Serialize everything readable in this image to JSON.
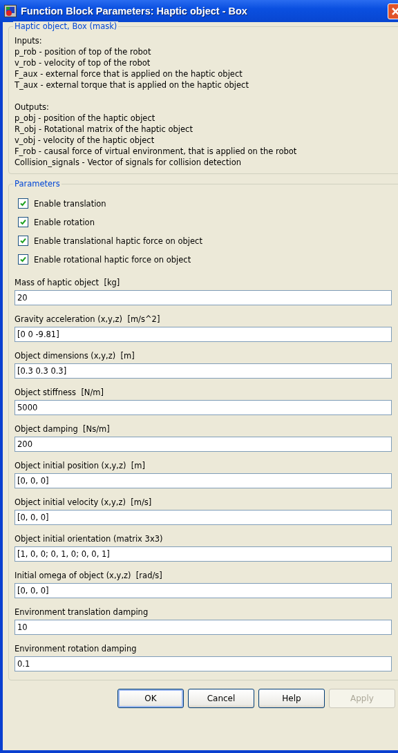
{
  "window": {
    "title": "Function Block Parameters: Haptic object - Box"
  },
  "description": {
    "title": "Haptic object, Box (mask)",
    "sections": [
      {
        "heading": "Inputs:",
        "lines": [
          "p_rob - position of top of the robot",
          "v_rob - velocity of top of the robot",
          "F_aux - external force that is applied on the haptic object",
          "T_aux - external torque that is applied on the haptic object"
        ]
      },
      {
        "heading": "Outputs:",
        "lines": [
          "p_obj - position of the haptic object",
          "R_obj - Rotational matrix of the haptic object",
          "v_obj - velocity of the haptic object",
          "F_rob - causal force of virtual environment, that is applied on the robot",
          "Collision_signals - Vector of signals for collision detection"
        ]
      }
    ]
  },
  "parameters": {
    "title": "Parameters",
    "checkboxes": [
      {
        "label": "Enable translation",
        "checked": true
      },
      {
        "label": "Enable rotation",
        "checked": true
      },
      {
        "label": "Enable translational haptic force on object",
        "checked": true
      },
      {
        "label": "Enable rotational haptic force on object",
        "checked": true
      }
    ],
    "fields": [
      {
        "label": "Mass of haptic object  [kg]",
        "value": "20"
      },
      {
        "label": "Gravity acceleration (x,y,z)  [m/s^2]",
        "value": "[0 0 -9.81]"
      },
      {
        "label": "Object dimensions (x,y,z)  [m]",
        "value": "[0.3 0.3 0.3]"
      },
      {
        "label": "Object stiffness  [N/m]",
        "value": "5000"
      },
      {
        "label": "Object damping  [Ns/m]",
        "value": "200"
      },
      {
        "label": "Object initial position (x,y,z)  [m]",
        "value": "[0, 0, 0]"
      },
      {
        "label": "Object initial velocity (x,y,z)  [m/s]",
        "value": "[0, 0, 0]"
      },
      {
        "label": "Object initial orientation (matrix 3x3)",
        "value": "[1, 0, 0; 0, 1, 0; 0, 0, 1]"
      },
      {
        "label": "Initial omega of object (x,y,z)  [rad/s]",
        "value": "[0, 0, 0]"
      },
      {
        "label": "Environment translation damping",
        "value": "10"
      },
      {
        "label": "Environment rotation damping",
        "value": "0.1"
      }
    ]
  },
  "buttons": [
    {
      "label": "OK",
      "default": true,
      "disabled": false
    },
    {
      "label": "Cancel",
      "default": false,
      "disabled": false
    },
    {
      "label": "Help",
      "default": false,
      "disabled": false
    },
    {
      "label": "Apply",
      "default": false,
      "disabled": true
    }
  ]
}
